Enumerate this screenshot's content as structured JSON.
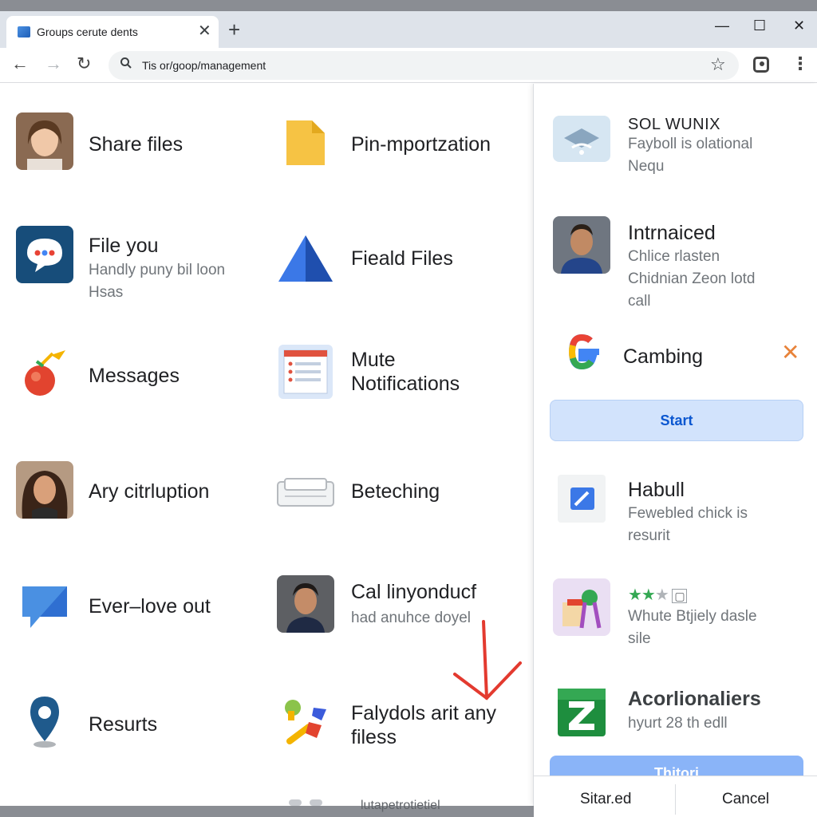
{
  "browser": {
    "tab_title": "Groups cerute dents",
    "tab_close": "✕",
    "new_tab": "+",
    "window_controls": {
      "minimize": "—",
      "maximize": "☐",
      "close": "✕"
    },
    "url": "Tis or/goop/management",
    "back": "←",
    "forward": "→",
    "reload": "↻",
    "bookmark_star": "☆",
    "menu": "⋮"
  },
  "grid": {
    "items": [
      {
        "title": "Share files",
        "icon": "user-avatar"
      },
      {
        "title": "Pin-mportzation",
        "icon": "folder-icon"
      },
      {
        "title": "File you",
        "subtitle": "Handly puny bil loon\nHsas",
        "icon": "chat-bubble-icon"
      },
      {
        "title": "Fieald Files",
        "icon": "drive-triangle-icon"
      },
      {
        "title": "Messages",
        "icon": "fruit-icon"
      },
      {
        "title": "Mute\nNotifications",
        "icon": "document-list-icon"
      },
      {
        "title": "Ary citrluption",
        "icon": "user-avatar"
      },
      {
        "title": "Beteching",
        "icon": "printer-tray-icon"
      },
      {
        "title": "Ever–love out",
        "icon": "message-icon"
      },
      {
        "title": "Cal linyonducf",
        "subtitle": "had anuhce doyel",
        "icon": "user-avatar"
      },
      {
        "title": "Resurts",
        "icon": "map-pin-icon"
      },
      {
        "title": "Falydols arit any\nfiless",
        "icon": "shapes-icon"
      }
    ],
    "footer_text": "lutapetrotietiel"
  },
  "side_panel": {
    "cards": [
      {
        "title": "SOL WUNIX",
        "subtitle": "Fayboll is olational\nNequ",
        "icon": "wifi-cloud-icon"
      },
      {
        "title": "Intrnaiced",
        "subtitle": "Chlice rlasten\nChidnian Zeon lotd\ncall",
        "icon": "user-avatar"
      },
      {
        "title": "Cambing",
        "icon": "google-g-icon"
      },
      {
        "title": "Habull",
        "subtitle": "Fewebled chick is\nresurit",
        "icon": "edit-square-icon"
      },
      {
        "title": "",
        "subtitle": "Whute Btjiely dasle\nsile",
        "icon": "app-illustration-icon"
      },
      {
        "title": "Acorlionaliers",
        "subtitle": "hyurt 28 th edll",
        "icon": "z-app-icon"
      }
    ],
    "dismiss": "✕",
    "start_label": "Start",
    "partial_button_label": "Thitori",
    "rating_stars": 2.5,
    "rating_max": 5,
    "dialog": {
      "confirm_label": "Sitar.ed",
      "cancel_label": "Cancel"
    }
  }
}
